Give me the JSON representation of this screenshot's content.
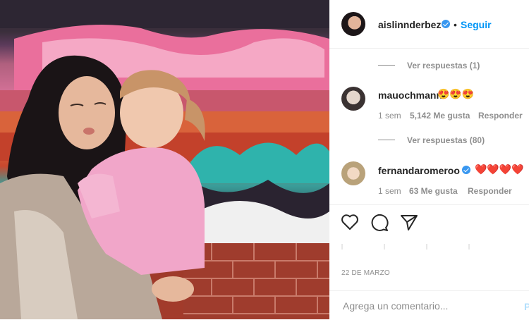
{
  "post": {
    "author": "aislinnderbez",
    "follow_label": "Seguir",
    "dot": "•",
    "date": "22 DE MARZO",
    "add_comment_placeholder": "Agrega un comentario...",
    "post_label": "P"
  },
  "comments": [
    {
      "replies_above": "Ver respuestas (1)",
      "username": "mauochmann",
      "verified": false,
      "text": "😍😍😍",
      "time": "1 sem",
      "likes": "5,142 Me gusta",
      "reply": "Responder"
    },
    {
      "replies_above": "Ver respuestas (80)",
      "username": "fernandaromeroo",
      "verified": true,
      "text": "❤️❤️❤️❤️",
      "time": "1 sem",
      "likes": "63 Me gusta",
      "reply": "Responder"
    }
  ],
  "icons": {
    "like": "heart-icon",
    "comment": "comment-icon",
    "share": "share-icon"
  },
  "colors": {
    "link_blue": "#0095f6",
    "verified_blue": "#3897f0",
    "muted": "#8e8e8e"
  }
}
